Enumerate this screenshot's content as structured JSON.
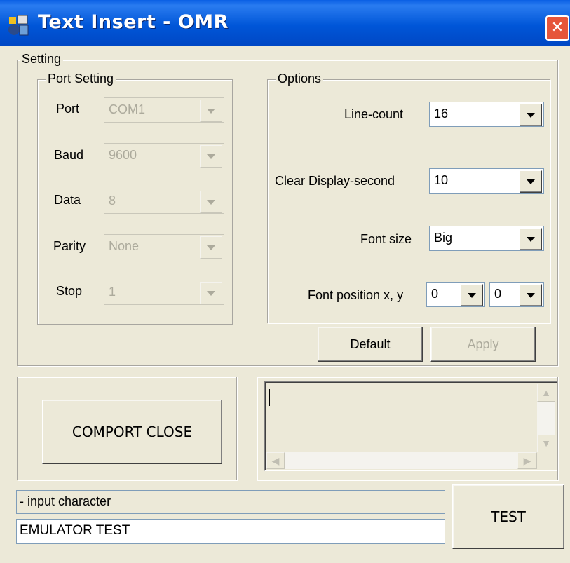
{
  "window": {
    "title": "Text Insert - OMR",
    "close_glyph": "✕",
    "app_icon": "application-icon"
  },
  "setting": {
    "legend": "Setting",
    "port_setting": {
      "legend": "Port Setting",
      "rows": [
        {
          "label": "Port",
          "value": "COM1"
        },
        {
          "label": "Baud",
          "value": "9600"
        },
        {
          "label": "Data",
          "value": "8"
        },
        {
          "label": "Parity",
          "value": "None"
        },
        {
          "label": "Stop",
          "value": "1"
        }
      ]
    },
    "options": {
      "legend": "Options",
      "line_count": {
        "label": "Line-count",
        "value": "16"
      },
      "clear_display": {
        "label": "Clear Display-second",
        "value": "10"
      },
      "font_size": {
        "label": "Font size",
        "value": "Big"
      },
      "font_position": {
        "label": "Font position x, y",
        "x": "0",
        "y": "0"
      }
    },
    "default_label": "Default",
    "apply_label": "Apply"
  },
  "comport_close_label": "COMPORT CLOSE",
  "log": {
    "text": "",
    "scroll_up": "▲",
    "scroll_down": "▼",
    "scroll_left": "◀",
    "scroll_right": "▶"
  },
  "input": {
    "caption": "- input character",
    "value": "EMULATOR TEST"
  },
  "test_label": "TEST",
  "colors": {
    "titlebar": "#0055e5",
    "window_bg": "#ece9d8",
    "close_button": "#e6553a"
  }
}
